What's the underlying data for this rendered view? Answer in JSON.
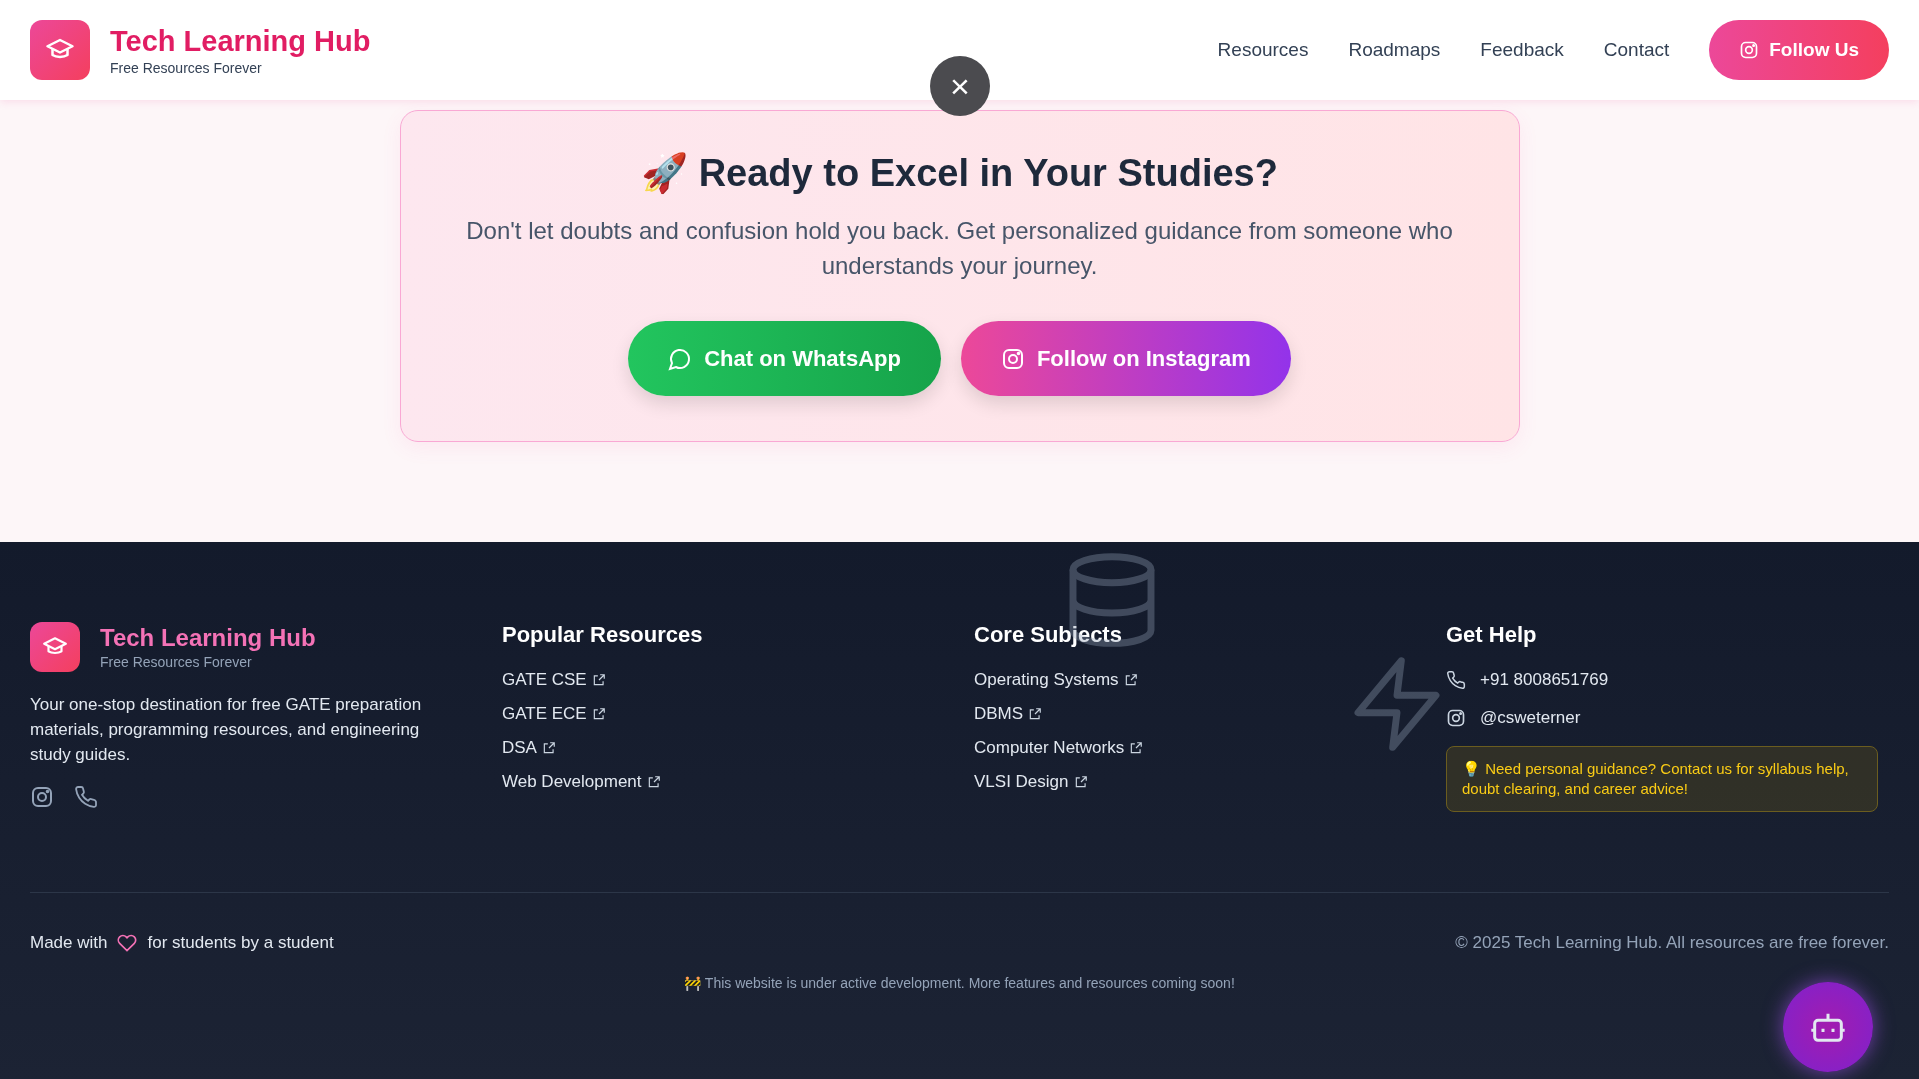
{
  "header": {
    "brand": "Tech Learning Hub",
    "tagline": "Free Resources Forever",
    "nav": [
      "Resources",
      "Roadmaps",
      "Feedback",
      "Contact"
    ],
    "follow_button": "Follow Us",
    "close_button": "×"
  },
  "cta": {
    "emoji": "🚀",
    "title": "Ready to Excel in Your Studies?",
    "text": "Don't let doubts and confusion hold you back. Get personalized guidance from someone who understands your journey.",
    "buttons": [
      {
        "kind": "whatsapp",
        "label": "Chat on WhatsApp"
      },
      {
        "kind": "instagram",
        "label": "Follow on Instagram"
      }
    ]
  },
  "footer": {
    "brand": "Tech Learning Hub",
    "tagline": "Free Resources Forever",
    "description": "Your one-stop destination for free GATE preparation materials, programming resources, and engineering study guides.",
    "columns": [
      {
        "title": "Popular Resources",
        "links": [
          "GATE CSE",
          "GATE ECE",
          "DSA",
          "Web Development"
        ]
      },
      {
        "title": "Core Subjects",
        "links": [
          "Operating Systems",
          "DBMS",
          "Computer Networks",
          "VLSI Design"
        ]
      }
    ],
    "help": {
      "title": "Get Help",
      "contacts": [
        {
          "kind": "phone",
          "text": "+91 8008651769"
        },
        {
          "kind": "instagram",
          "text": "@csweterner"
        }
      ],
      "tip_emoji": "💡",
      "tip": "Need personal guidance? Contact us for syllabus help, doubt clearing, and career advice!"
    },
    "made_with_before": "Made with",
    "made_with_after": "for students by a student",
    "copyright": "© 2025 Tech Learning Hub. All resources are free forever.",
    "dev_emoji": "🚧",
    "dev_note": "This website is under active development. More features and resources coming soon!"
  }
}
